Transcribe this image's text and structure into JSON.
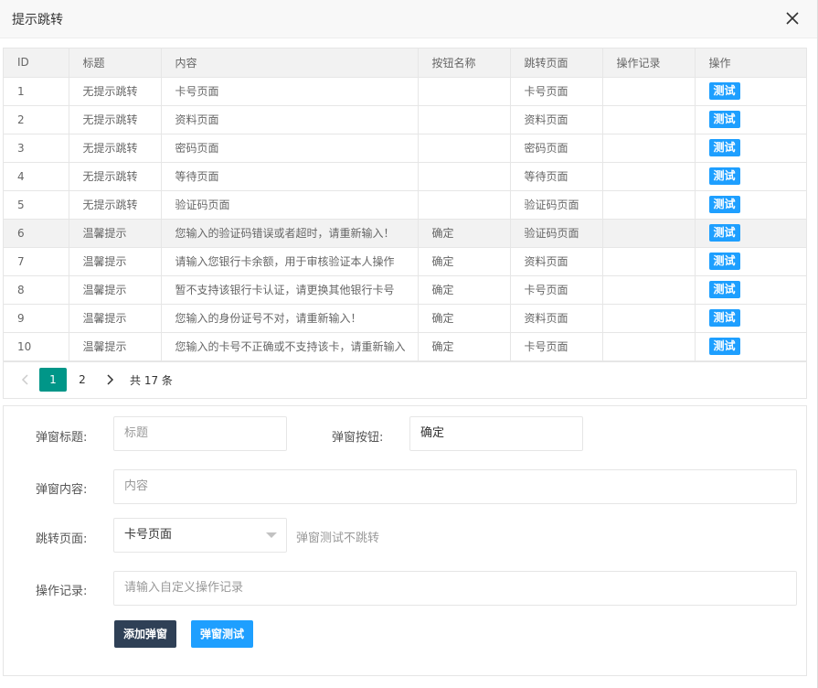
{
  "dialog": {
    "title": "提示跳转"
  },
  "table": {
    "headers": [
      "ID",
      "标题",
      "内容",
      "按钮名称",
      "跳转页面",
      "操作记录",
      "操作"
    ],
    "action_label": "测试",
    "rows": [
      {
        "id": "1",
        "title": "无提示跳转",
        "content": "卡号页面",
        "button": "",
        "page": "卡号页面",
        "record": ""
      },
      {
        "id": "2",
        "title": "无提示跳转",
        "content": "资料页面",
        "button": "",
        "page": "资料页面",
        "record": ""
      },
      {
        "id": "3",
        "title": "无提示跳转",
        "content": "密码页面",
        "button": "",
        "page": "密码页面",
        "record": ""
      },
      {
        "id": "4",
        "title": "无提示跳转",
        "content": "等待页面",
        "button": "",
        "page": "等待页面",
        "record": ""
      },
      {
        "id": "5",
        "title": "无提示跳转",
        "content": "验证码页面",
        "button": "",
        "page": "验证码页面",
        "record": ""
      },
      {
        "id": "6",
        "title": "温馨提示",
        "content": "您输入的验证码错误或者超时，请重新输入！",
        "button": "确定",
        "page": "验证码页面",
        "record": ""
      },
      {
        "id": "7",
        "title": "温馨提示",
        "content": "请输入您银行卡余额，用于审核验证本人操作",
        "button": "确定",
        "page": "资料页面",
        "record": ""
      },
      {
        "id": "8",
        "title": "温馨提示",
        "content": "暂不支持该银行卡认证，请更换其他银行卡号",
        "button": "确定",
        "page": "卡号页面",
        "record": ""
      },
      {
        "id": "9",
        "title": "温馨提示",
        "content": "您输入的身份证号不对，请重新输入！",
        "button": "确定",
        "page": "资料页面",
        "record": ""
      },
      {
        "id": "10",
        "title": "温馨提示",
        "content": "您输入的卡号不正确或不支持该卡，请重新输入",
        "button": "确定",
        "page": "卡号页面",
        "record": ""
      }
    ]
  },
  "pager": {
    "pages": [
      "1",
      "2"
    ],
    "current": "1",
    "total": "共 17 条"
  },
  "form": {
    "title_label": "弹窗标题:",
    "title_placeholder": "标题",
    "button_label": "弹窗按钮:",
    "button_value": "确定",
    "content_label": "弹窗内容:",
    "content_placeholder": "内容",
    "page_label": "跳转页面:",
    "page_value": "卡号页面",
    "page_hint": "弹窗测试不跳转",
    "record_label": "操作记录:",
    "record_placeholder": "请输入自定义操作记录",
    "add_button": "添加弹窗",
    "test_button": "弹窗测试"
  }
}
